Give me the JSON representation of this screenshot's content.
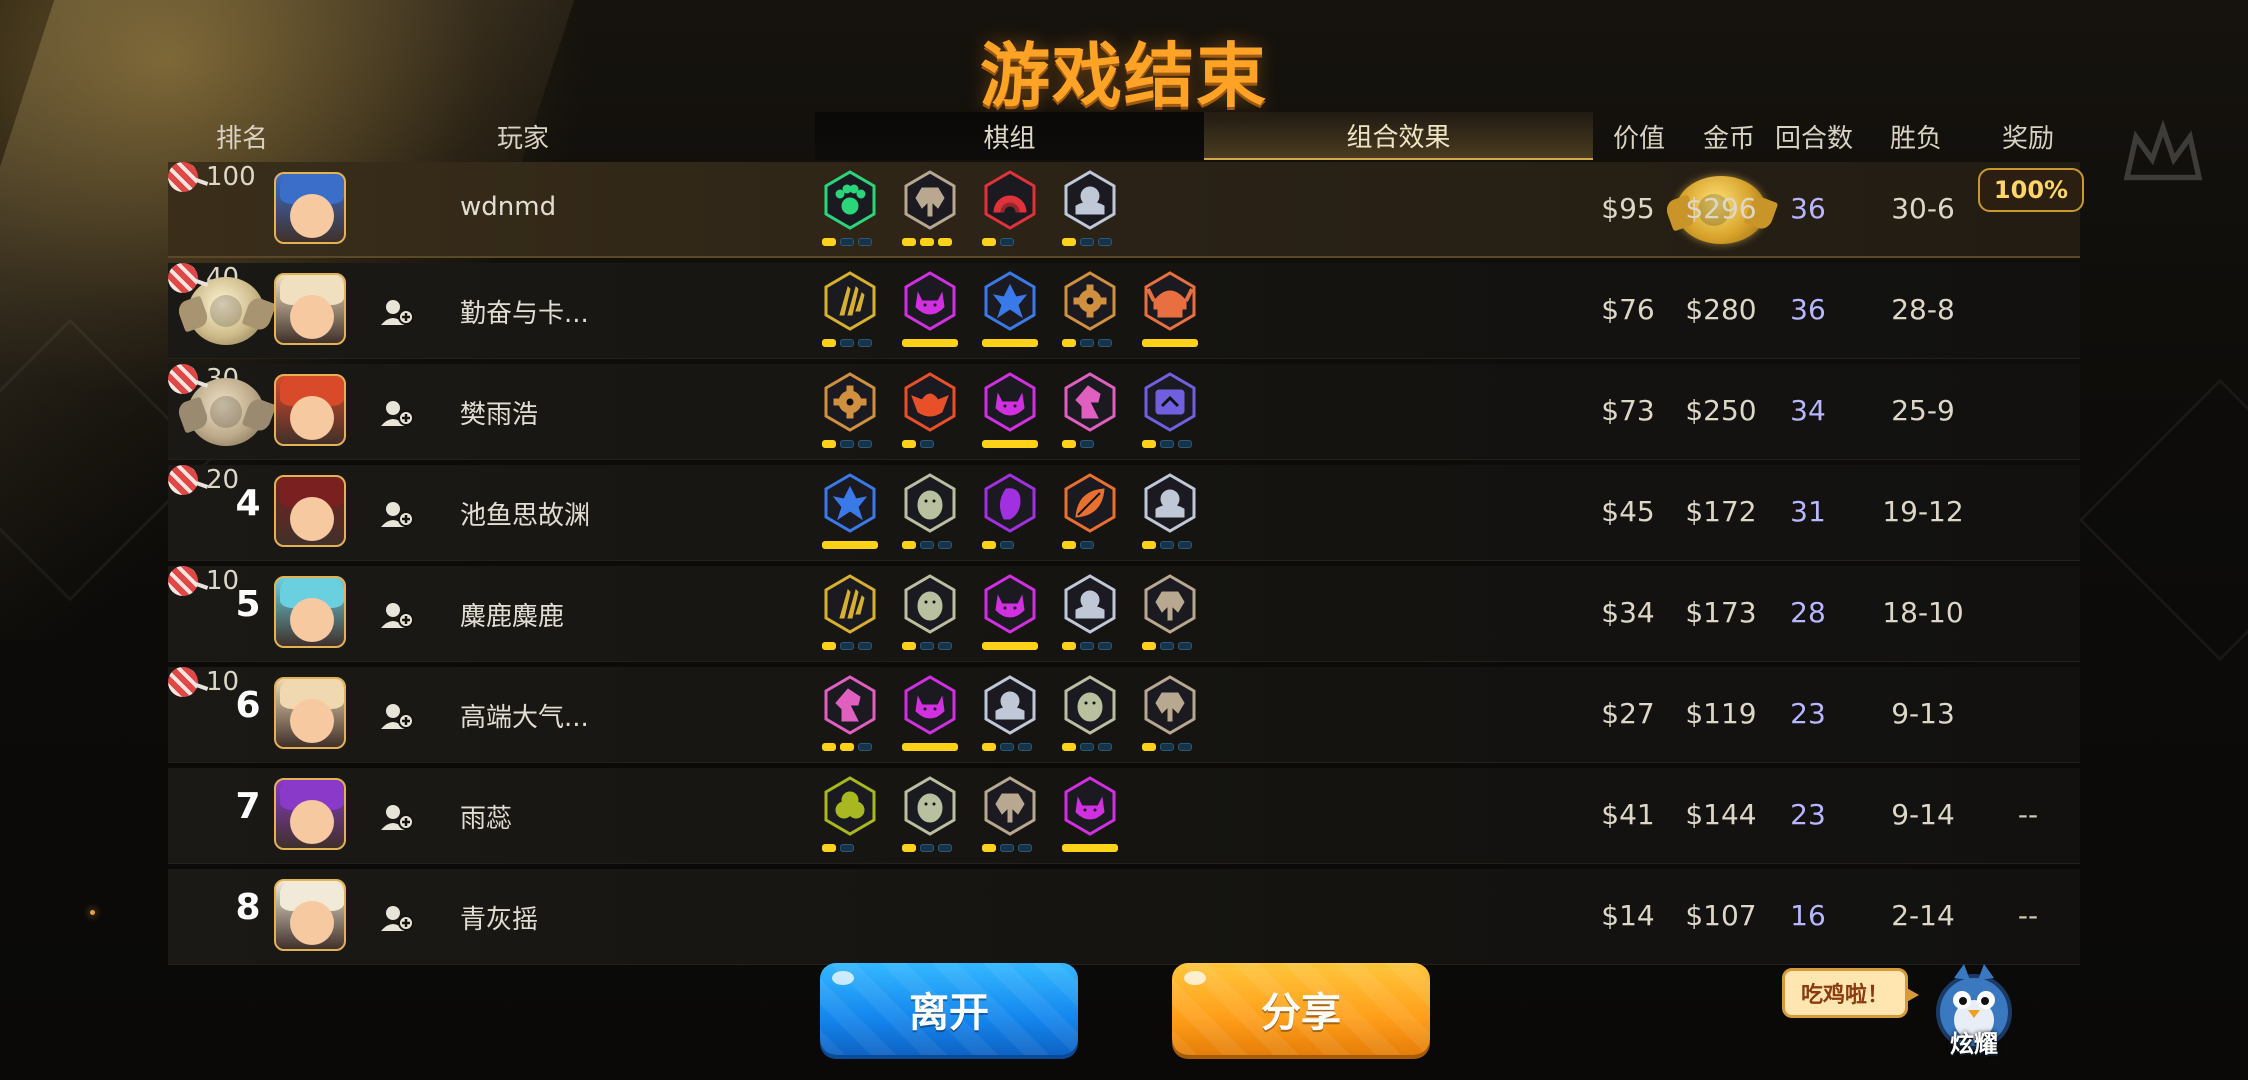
{
  "title": "游戏结束",
  "headers": {
    "rank": "排名",
    "player": "玩家",
    "value": "价值",
    "gold": "金币",
    "rounds": "回合数",
    "winloss": "胜负",
    "reward": "奖励"
  },
  "tabs": [
    {
      "label": "棋组",
      "active": false
    },
    {
      "label": "组合效果",
      "active": true
    }
  ],
  "colors": {
    "accent": "#ffa326",
    "pip_on": "#ffd21a",
    "rounds": "#b7b6ff"
  },
  "rows": [
    {
      "rank": 1,
      "medal": "gold",
      "name": "wdnmd",
      "value": "$95",
      "gold": "$296",
      "rounds": "36",
      "winloss": "30-6",
      "reward": "100",
      "reward_badge": "100%",
      "traits": [
        {
          "icon": "paw-icon",
          "color": "#2bd67a",
          "pips": [
            true,
            false,
            false
          ]
        },
        {
          "icon": "axe-icon",
          "color": "#b8a890",
          "pips": [
            true,
            true,
            true
          ]
        },
        {
          "icon": "arch-icon",
          "color": "#e0323a",
          "pips": [
            true,
            false
          ]
        },
        {
          "icon": "helm-icon",
          "color": "#c0c8d8",
          "pips": [
            true,
            false,
            false
          ]
        }
      ]
    },
    {
      "rank": 2,
      "medal": "silver",
      "name": "勤奋与卡...",
      "value": "$76",
      "gold": "$280",
      "rounds": "36",
      "winloss": "28-8",
      "reward": "40",
      "traits": [
        {
          "icon": "claw-icon",
          "color": "#d8b030",
          "pips": [
            true,
            false,
            false
          ]
        },
        {
          "icon": "demon-icon",
          "color": "#d030e0",
          "pips": [
            "full"
          ]
        },
        {
          "icon": "crystal-icon",
          "color": "#3a7ae8",
          "pips": [
            "full"
          ]
        },
        {
          "icon": "gear-icon",
          "color": "#d09040",
          "pips": [
            true,
            false,
            false
          ]
        },
        {
          "icon": "viking-icon",
          "color": "#e87040",
          "pips": [
            "full"
          ]
        }
      ]
    },
    {
      "rank": 3,
      "medal": "bronze",
      "name": "樊雨浩",
      "value": "$73",
      "gold": "$250",
      "rounds": "34",
      "winloss": "25-9",
      "reward": "30",
      "traits": [
        {
          "icon": "gear-icon",
          "color": "#d09040",
          "pips": [
            true,
            false,
            false
          ]
        },
        {
          "icon": "goblin-icon",
          "color": "#e8502a",
          "pips": [
            true,
            false
          ]
        },
        {
          "icon": "demon-icon",
          "color": "#d030e0",
          "pips": [
            "full"
          ]
        },
        {
          "icon": "knight-icon",
          "color": "#e060c0",
          "pips": [
            true,
            false
          ]
        },
        {
          "icon": "mech-icon",
          "color": "#7060e0",
          "pips": [
            true,
            false,
            false
          ]
        }
      ]
    },
    {
      "rank": 4,
      "medal": "",
      "name": "池鱼思故渊",
      "value": "$45",
      "gold": "$172",
      "rounds": "31",
      "winloss": "19-12",
      "reward": "20",
      "traits": [
        {
          "icon": "crystal-icon",
          "color": "#3a7ae8",
          "pips": [
            "full"
          ]
        },
        {
          "icon": "penguin-icon",
          "color": "#b8c0a0",
          "pips": [
            true,
            false,
            false
          ]
        },
        {
          "icon": "spirit-icon",
          "color": "#a030e0",
          "pips": [
            true,
            false
          ]
        },
        {
          "icon": "leaf-icon",
          "color": "#e87030",
          "pips": [
            true,
            false
          ]
        },
        {
          "icon": "helm-icon",
          "color": "#c0c8d8",
          "pips": [
            true,
            false,
            false
          ]
        }
      ]
    },
    {
      "rank": 5,
      "medal": "",
      "name": "麋鹿麋鹿",
      "value": "$34",
      "gold": "$173",
      "rounds": "28",
      "winloss": "18-10",
      "reward": "10",
      "traits": [
        {
          "icon": "claw-icon",
          "color": "#d8b030",
          "pips": [
            true,
            false,
            false
          ]
        },
        {
          "icon": "penguin-icon",
          "color": "#b8c0a0",
          "pips": [
            true,
            false,
            false
          ]
        },
        {
          "icon": "demon-icon",
          "color": "#d030e0",
          "pips": [
            "full"
          ]
        },
        {
          "icon": "helm-icon",
          "color": "#c0c8d8",
          "pips": [
            true,
            false,
            false
          ]
        },
        {
          "icon": "axe-icon",
          "color": "#b8a890",
          "pips": [
            true,
            false,
            false
          ]
        }
      ]
    },
    {
      "rank": 6,
      "medal": "",
      "name": "高端大气...",
      "value": "$27",
      "gold": "$119",
      "rounds": "23",
      "winloss": "9-13",
      "reward": "10",
      "traits": [
        {
          "icon": "knight-icon",
          "color": "#e060c0",
          "pips": [
            true,
            true,
            false
          ]
        },
        {
          "icon": "demon-icon",
          "color": "#d030e0",
          "pips": [
            "full"
          ]
        },
        {
          "icon": "helm-icon",
          "color": "#c0c8d8",
          "pips": [
            true,
            false,
            false
          ]
        },
        {
          "icon": "penguin-icon",
          "color": "#b8c0a0",
          "pips": [
            true,
            false,
            false
          ]
        },
        {
          "icon": "axe-icon",
          "color": "#b8a890",
          "pips": [
            true,
            false,
            false
          ]
        }
      ]
    },
    {
      "rank": 7,
      "medal": "",
      "name": "雨蕊",
      "value": "$41",
      "gold": "$144",
      "rounds": "23",
      "winloss": "9-14",
      "reward": "--",
      "traits": [
        {
          "icon": "slime-icon",
          "color": "#a8b820",
          "pips": [
            true,
            false
          ]
        },
        {
          "icon": "penguin-icon",
          "color": "#b8c0a0",
          "pips": [
            true,
            false,
            false
          ]
        },
        {
          "icon": "axe-icon",
          "color": "#b8a890",
          "pips": [
            true,
            false,
            false
          ]
        },
        {
          "icon": "demon-icon",
          "color": "#d030e0",
          "pips": [
            "full"
          ]
        }
      ]
    },
    {
      "rank": 8,
      "medal": "",
      "name": "青灰摇",
      "value": "$14",
      "gold": "$107",
      "rounds": "16",
      "winloss": "2-14",
      "reward": "--",
      "traits": []
    }
  ],
  "buttons": {
    "leave": "离开",
    "share": "分享"
  },
  "bubble": "吃鸡啦！",
  "mascot_label": "炫耀"
}
